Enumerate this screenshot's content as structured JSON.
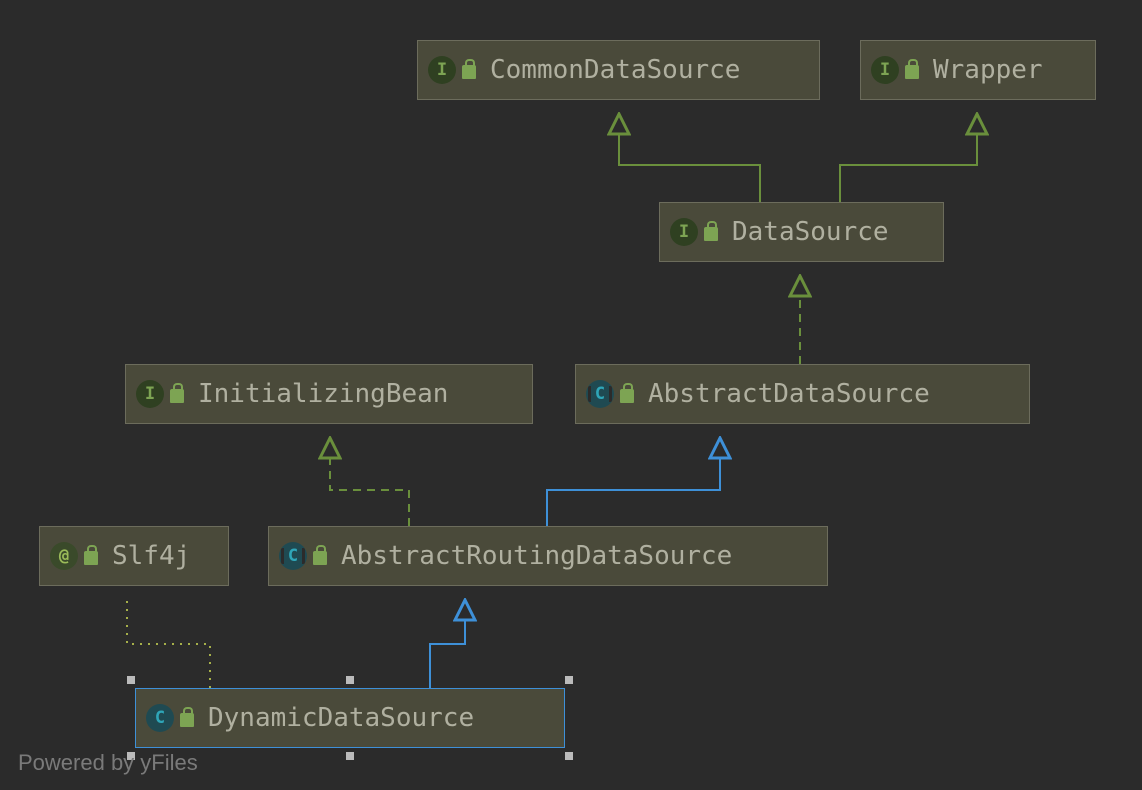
{
  "watermark": "Powered by yFiles",
  "badges": {
    "interface": "I",
    "annotation": "@",
    "class": "C",
    "abstract": "C"
  },
  "nodes": {
    "commonDataSource": {
      "label": "CommonDataSource",
      "kind": "interface"
    },
    "wrapper": {
      "label": "Wrapper",
      "kind": "interface"
    },
    "dataSource": {
      "label": "DataSource",
      "kind": "interface"
    },
    "initializingBean": {
      "label": "InitializingBean",
      "kind": "interface"
    },
    "abstractDataSource": {
      "label": "AbstractDataSource",
      "kind": "abstract"
    },
    "slf4j": {
      "label": "Slf4j",
      "kind": "annotation"
    },
    "abstractRoutingDataSource": {
      "label": "AbstractRoutingDataSource",
      "kind": "abstract"
    },
    "dynamicDataSource": {
      "label": "DynamicDataSource",
      "kind": "class",
      "selected": true
    }
  },
  "colors": {
    "extends": "#3e90d8",
    "implements": "#6a8f3c",
    "annotation": "#a6b04a"
  }
}
